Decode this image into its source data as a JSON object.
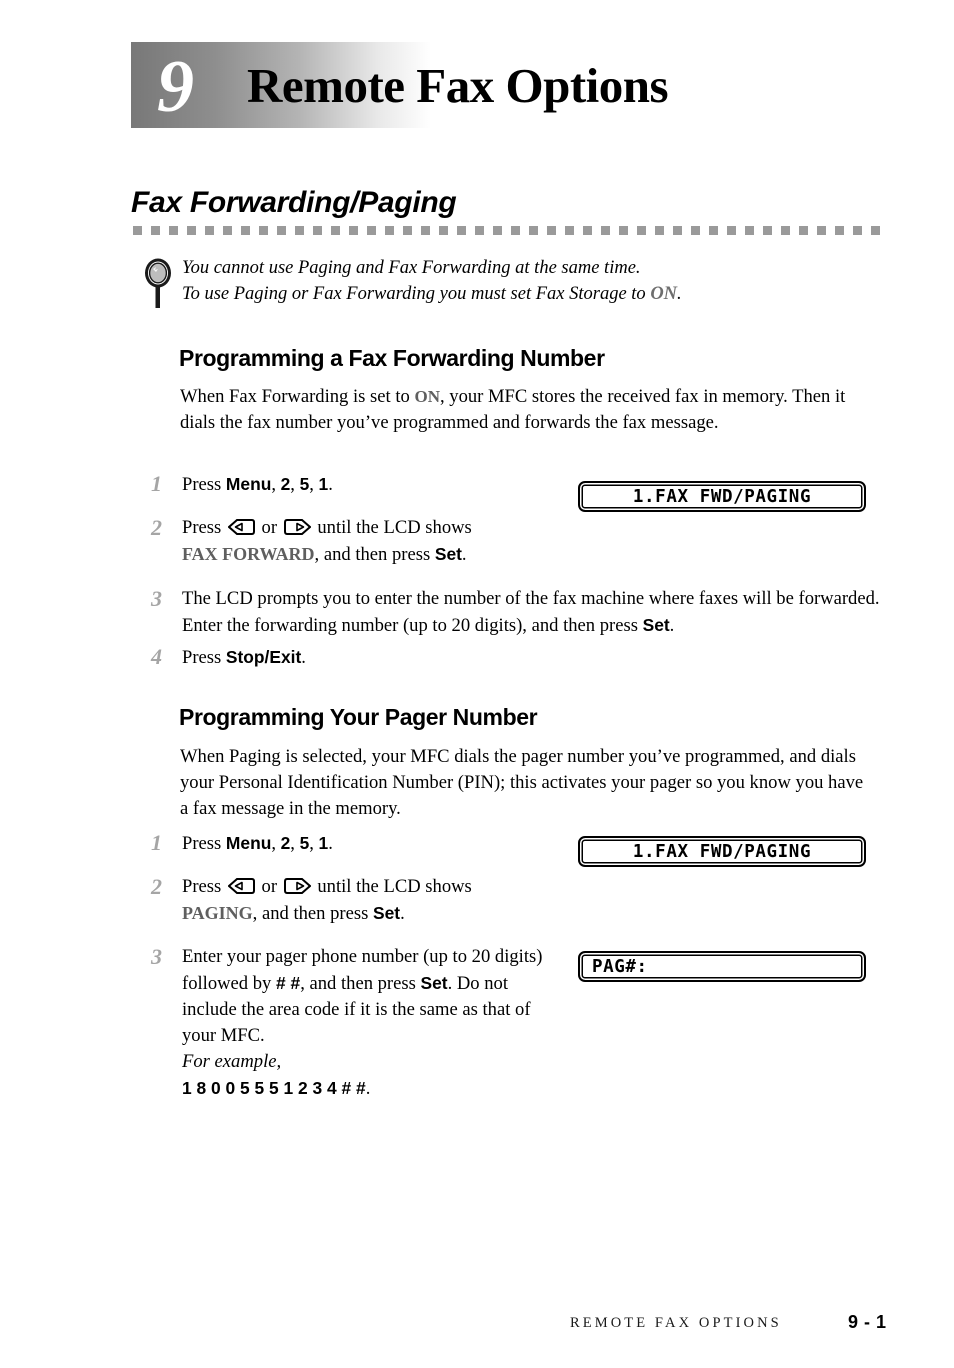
{
  "chapter": {
    "number": "9",
    "title": "Remote Fax Options"
  },
  "section": {
    "heading": "Fax Forwarding/Paging"
  },
  "note": {
    "icon": "magnifier-icon",
    "line1": "You cannot use Paging and Fax Forwarding at the same time.",
    "line2_pre": "To use Paging or Fax Forwarding you must set Fax Storage to ",
    "line2_emphasis": "ON",
    "line2_post": "."
  },
  "subsections": [
    {
      "heading": "Programming a Fax Forwarding Number",
      "intro_pre": "When Fax Forwarding is set to ",
      "intro_emphasis": "ON",
      "intro_post": ", your MFC stores the received fax in memory. Then it dials the fax number you’ve programmed and forwards the fax message.",
      "steps": [
        {
          "num": "1",
          "pre": "Press ",
          "key1": "Menu",
          "sep1": ", ",
          "key2": "2",
          "sep2": ", ",
          "key3": "5",
          "sep3": ", ",
          "key4": "1",
          "post": "."
        },
        {
          "num": "2",
          "pre": "Press ",
          "left_key": "left-arrow-key",
          "mid": " or ",
          "right_key": "right-arrow-key",
          "after_keys": " until the LCD shows",
          "lcd_value": "FAX FORWARD",
          "tail_pre": ", and then press ",
          "tail_key": "Set",
          "tail_post": "."
        },
        {
          "num": "3",
          "pre": "The LCD prompts you to enter the number of the fax machine where faxes will be forwarded. Enter the forwarding number (up to 20 digits), and then press ",
          "tail_key": "Set",
          "tail_post": "."
        },
        {
          "num": "4",
          "pre": "Press ",
          "tail_key": "Stop/Exit",
          "tail_post": "."
        }
      ],
      "lcd": "1.FAX FWD/PAGING"
    },
    {
      "heading": "Programming Your Pager Number",
      "intro": "When Paging is selected, your MFC dials the pager number you’ve programmed, and dials your Personal Identification Number (PIN); this activates your pager so you know you have a fax message in the memory.",
      "steps": [
        {
          "num": "1",
          "pre": "Press ",
          "key1": "Menu",
          "sep1": ", ",
          "key2": "2",
          "sep2": ", ",
          "key3": "5",
          "sep3": ", ",
          "key4": "1",
          "post": "."
        },
        {
          "num": "2",
          "pre": "Press ",
          "left_key": "left-arrow-key",
          "mid": " or ",
          "right_key": "right-arrow-key",
          "after_keys": " until the LCD shows",
          "lcd_value": "PAGING",
          "tail_pre": ", and then press ",
          "tail_key": "Set",
          "tail_post": "."
        },
        {
          "num": "3",
          "line1": "Enter your pager phone number (up to 20",
          "line2_pre": "digits) followed by ",
          "line2_key": "# #",
          "line2_post": ", and then press",
          "line3_key": "Set",
          "line3_post": ". Do not include the area code if it is",
          "line4": "the same as that of your MFC.",
          "line5_italic": "For example,",
          "line6_key": "1 8 0 0 5 5 5 1 2 3 4 # #",
          "line6_post": "."
        }
      ],
      "lcd_1": "1.FAX FWD/PAGING",
      "lcd_2": "PAG#:"
    }
  ],
  "footer": {
    "label": "REMOTE FAX OPTIONS",
    "page": "9 - 1"
  },
  "colors": {
    "gray_rule": "#9a9a9a",
    "step_number": "#a5a5a5",
    "emphasis_gray": "#5f5f5f",
    "gradient_dark": "#787878"
  }
}
